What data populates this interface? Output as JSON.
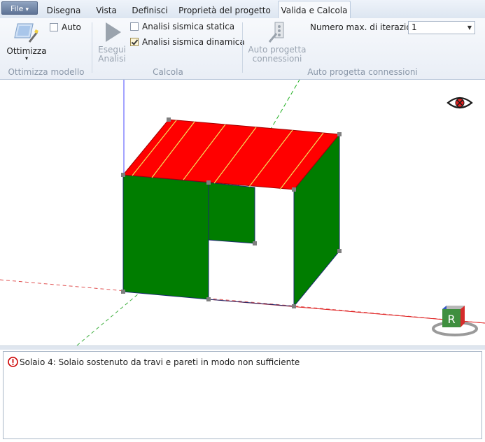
{
  "ribbon": {
    "file_label": "File",
    "tabs": [
      "Disegna",
      "Vista",
      "Definisci",
      "Proprietà del progetto",
      "Valida e Calcola"
    ],
    "active_tab": "Valida e Calcola",
    "optimize": {
      "button_label": "Ottimizza",
      "auto_label": "Auto",
      "auto_checked": false,
      "group_label": "Ottimizza modello"
    },
    "calcola": {
      "run_label_line1": "Esegui",
      "run_label_line2": "Analisi",
      "static_label": "Analisi sismica statica",
      "static_checked": false,
      "dynamic_label": "Analisi sismica dinamica",
      "dynamic_checked": true,
      "group_label": "Calcola"
    },
    "connections": {
      "button_line1": "Auto progetta",
      "button_line2": "connessioni",
      "iterations_label": "Numero max. di iterazioni",
      "iterations_value": "1",
      "group_label": "Auto progetta connessioni"
    }
  },
  "viewport": {
    "view_icon": "eye-icon",
    "cube_icon": "view-cube-icon",
    "cube_face_label": "R",
    "colors": {
      "roof": "#ff0000",
      "roof_stripes": "#f2e05a",
      "walls": "#007d00",
      "wall_edges": "#1a2a6e",
      "axis_x": "#e02020",
      "axis_y": "#20b020",
      "axis_z": "#3c3cff"
    }
  },
  "messages": [
    {
      "icon": "error-icon",
      "text": "Solaio 4: Solaio sostenuto da travi e pareti in modo non sufficiente"
    }
  ]
}
